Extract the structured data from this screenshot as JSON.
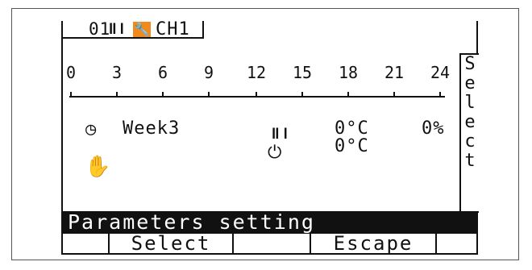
{
  "header": {
    "channel_id": "01",
    "channel_icon": "heating-bars-icon",
    "tool_icon": "wrench-icon",
    "channel_name": "CH1"
  },
  "timeline": {
    "ticks": [
      "0",
      "3",
      "6",
      "9",
      "12",
      "15",
      "18",
      "21",
      "24"
    ]
  },
  "program": {
    "clock_icon": "clock-icon",
    "hand_icon": "hand-icon",
    "week_label": "Week3",
    "heat_icon": "heating-bars-icon",
    "power_icon": "power-icon",
    "temp1": "0°C",
    "temp2": "0°C",
    "percent": "0%"
  },
  "side_button": {
    "label": "Select",
    "letters": [
      "S",
      "e",
      "l",
      "e",
      "c",
      "t"
    ]
  },
  "status_bar": {
    "text": "Parameters setting"
  },
  "softkeys": [
    "",
    "Select",
    "",
    "Escape",
    ""
  ],
  "colors": {
    "accent": "#f08a1e",
    "fg": "#111111",
    "bg": "#ffffff"
  }
}
